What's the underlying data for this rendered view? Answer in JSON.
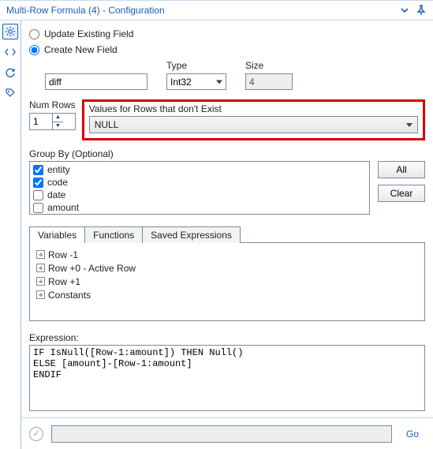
{
  "title": "Multi-Row Formula (4) - Configuration",
  "radios": {
    "update_existing": "Update Existing Field",
    "create_new": "Create New  Field"
  },
  "new_field": {
    "name_value": "diff",
    "type_label": "Type",
    "type_value": "Int32",
    "size_label": "Size",
    "size_value": "4"
  },
  "num_rows": {
    "label": "Num Rows",
    "value": "1"
  },
  "values_missing": {
    "label": "Values for Rows that don't Exist",
    "selected": "NULL"
  },
  "group_by": {
    "label": "Group By (Optional)",
    "items": [
      {
        "label": "entity",
        "checked": true
      },
      {
        "label": "code",
        "checked": true
      },
      {
        "label": "date",
        "checked": false
      },
      {
        "label": "amount",
        "checked": false
      }
    ],
    "all_button": "All",
    "clear_button": "Clear"
  },
  "tabs": {
    "variables": "Variables",
    "functions": "Functions",
    "saved": "Saved Expressions"
  },
  "tree": {
    "row_minus1": "Row -1",
    "row_active": "Row +0 - Active Row",
    "row_plus1": "Row +1",
    "constants": "Constants"
  },
  "expression": {
    "label": "Expression:",
    "value": "IF IsNull([Row-1:amount]) THEN Null()\nELSE [amount]-[Row-1:amount]\nENDIF"
  },
  "footer": {
    "go": "Go"
  }
}
